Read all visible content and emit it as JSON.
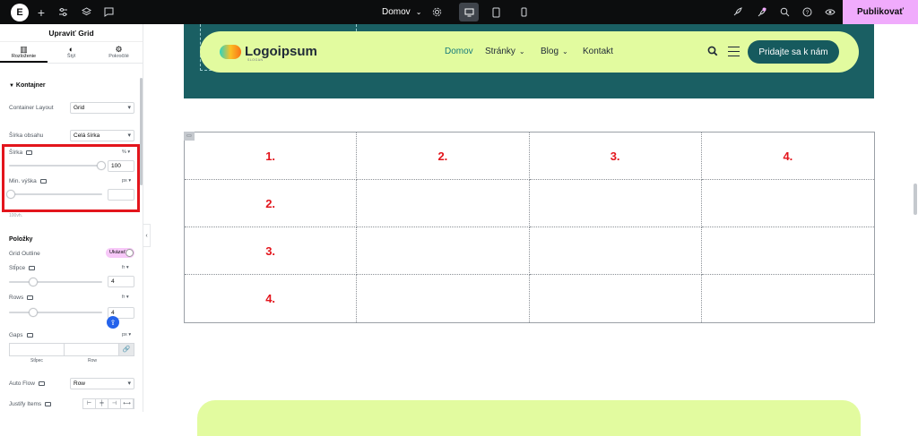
{
  "topbar": {
    "logo": "E",
    "page_name": "Domov",
    "publish_label": "Publikovať",
    "icons": [
      "elementor-logo-icon",
      "add-icon",
      "sliders-icon",
      "layers-icon",
      "comment-icon",
      "settings-icon",
      "desktop-icon",
      "tablet-icon",
      "mobile-icon",
      "rocket-icon",
      "notifications-icon",
      "search-icon",
      "help-icon",
      "preview-icon"
    ]
  },
  "panel": {
    "title": "Upraviť Grid",
    "tabs": [
      {
        "label": "Rozloženie",
        "icon": "layout-icon",
        "active": true
      },
      {
        "label": "Štýl",
        "icon": "style-icon",
        "active": false
      },
      {
        "label": "Pokročilé",
        "icon": "advanced-icon",
        "active": false
      }
    ],
    "section_kontajner": "Kontajner",
    "container_layout_label": "Container Layout",
    "container_layout_value": "Grid",
    "content_width_label": "Šírka obsahu",
    "content_width_value": "Celá šírka",
    "width_label": "Šírka",
    "width_unit": "%",
    "width_value": "100",
    "width_level": 1.0,
    "min_height_label": "Min. výška",
    "min_height_unit": "px",
    "min_height_value": "",
    "hint": "100vh.",
    "section_items": "Položky",
    "grid_outline_label": "Grid Outline",
    "grid_outline_value": "Ukázať",
    "columns_label": "Stĺpce",
    "columns_unit": "fr",
    "columns_value": "4",
    "rows_label": "Rows",
    "rows_unit": "fr",
    "rows_value": "4",
    "gaps_label": "Gaps",
    "gaps_unit": "px",
    "gap_column_label": "Stĺpec",
    "gap_row_label": "Row",
    "auto_flow_label": "Auto Flow",
    "auto_flow_value": "Row",
    "justify_items_label": "Justify Items",
    "highlight_color": "#e3151c"
  },
  "site": {
    "brand_name": "Logoipsum",
    "brand_tag": "SLOGAN",
    "nav": [
      {
        "label": "Domov",
        "active": true,
        "dropdown": false
      },
      {
        "label": "Stránky",
        "active": false,
        "dropdown": true
      },
      {
        "label": "Blog",
        "active": false,
        "dropdown": true
      },
      {
        "label": "Kontakt",
        "active": false,
        "dropdown": false
      }
    ],
    "cta_label": "Pridajte sa k nám",
    "hero_color": "#1a5f63",
    "nav_color": "#e2fb9f"
  },
  "grid": {
    "columns": 4,
    "rows": 4,
    "cells": [
      "1.",
      "2.",
      "3.",
      "4.",
      "2.",
      "",
      "",
      "",
      "3.",
      "",
      "",
      "",
      "4.",
      "",
      "",
      ""
    ],
    "label_color": "#e3151c"
  }
}
